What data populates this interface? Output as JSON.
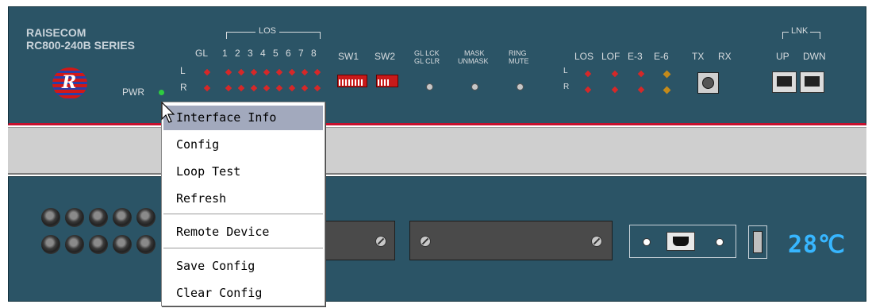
{
  "device": {
    "brand_line1": "RAISECOM",
    "brand_line2": "RC800-240B SERIES",
    "logo_letter": "R",
    "pwr_label": "PWR",
    "los_group_label": "LOS",
    "gl_label": "GL",
    "port_numbers": [
      "1",
      "2",
      "3",
      "4",
      "5",
      "6",
      "7",
      "8"
    ],
    "row_l": "L",
    "row_r": "R",
    "sw1_label": "SW1",
    "sw2_label": "SW2",
    "gl_lck": "GL LCK",
    "gl_clr": "GL CLR",
    "mask": "MASK",
    "unmask": "UNMASK",
    "ring": "RING",
    "mute": "MUTE",
    "status_headers": [
      "LOS",
      "LOF",
      "E-3",
      "E-6"
    ],
    "tx_label": "TX",
    "rx_label": "RX",
    "lnk_label": "LNK",
    "up_label": "UP",
    "dwn_label": "DWN",
    "temperature": "28℃"
  },
  "context_menu": {
    "items": [
      {
        "label": "Interface Info",
        "highlighted": true
      },
      {
        "label": "Config"
      },
      {
        "label": "Loop Test"
      },
      {
        "label": "Refresh"
      },
      {
        "label": "Remote Device"
      },
      {
        "label": "Save Config"
      },
      {
        "label": "Clear Config"
      }
    ]
  },
  "colors": {
    "panel": "#2b5466",
    "led_red": "#d62828",
    "led_amber": "#c48a1a",
    "pwr_led": "#2ecc40",
    "menu_highlight": "#a2a9bd",
    "temp_display": "#37b6ff"
  }
}
